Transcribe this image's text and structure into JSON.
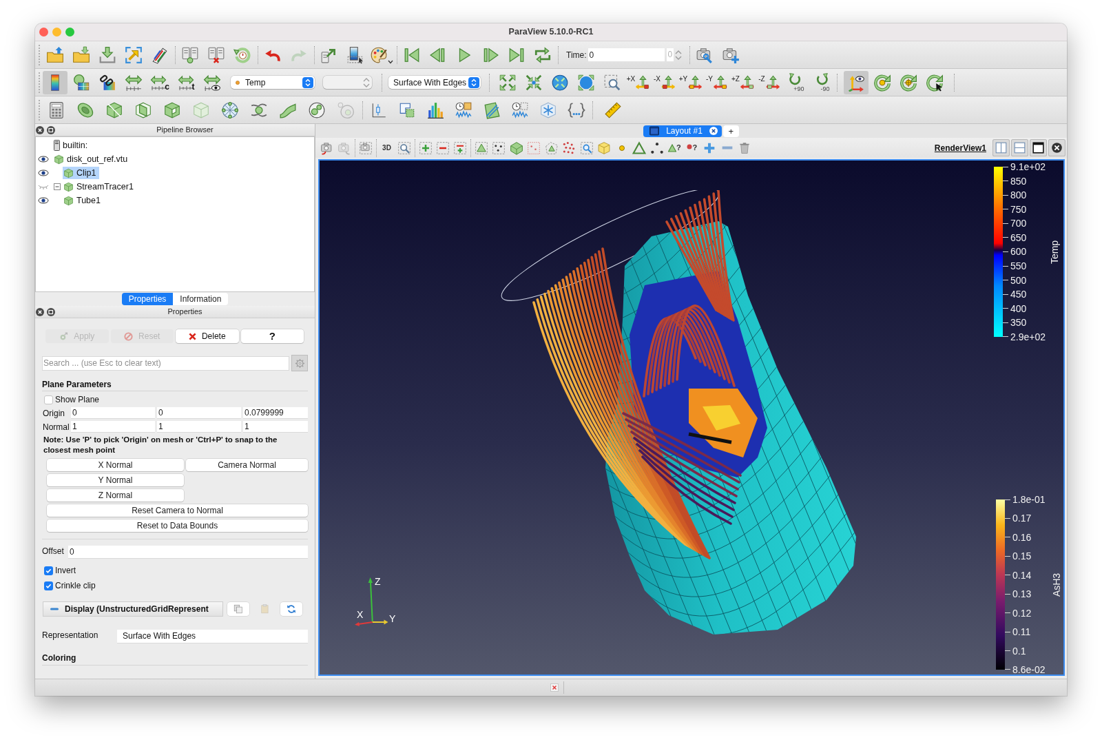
{
  "window": {
    "title": "ParaView 5.10.0-RC1"
  },
  "toolbar": {
    "time_label": "Time:",
    "time_value": "0",
    "time_index": "0",
    "color_legend_button": {
      "on": true
    },
    "rescale_marks": [
      "c",
      "t"
    ],
    "color_array": "Temp",
    "representation": "Surface With Edges",
    "view_buttons": [
      "+X",
      "-X",
      "+Y",
      "-Y",
      "+Z",
      "-Z"
    ],
    "rotate_buttons": [
      "+90",
      "-90"
    ],
    "orientation_axes_button": {
      "on": true
    }
  },
  "pipeline_browser": {
    "title": "Pipeline Browser",
    "items": [
      {
        "label": "builtin:",
        "selected": false,
        "children": [
          {
            "label": "disk_out_ref.vtu",
            "visible": true,
            "selected": false,
            "children": [
              {
                "label": "Clip1",
                "visible": true,
                "selected": true
              },
              {
                "label": "StreamTracer1",
                "visible": false,
                "selected": false,
                "expanded": true,
                "children": [
                  {
                    "label": "Tube1",
                    "visible": true,
                    "selected": false
                  }
                ]
              }
            ]
          }
        ]
      }
    ]
  },
  "panel_tabs": [
    {
      "label": "Properties",
      "selected": true
    },
    {
      "label": "Information",
      "selected": false
    }
  ],
  "properties": {
    "title": "Properties",
    "buttons": [
      {
        "label": "Apply",
        "disabled": true
      },
      {
        "label": "Reset",
        "disabled": true
      },
      {
        "label": "Delete",
        "disabled": false
      },
      {
        "label": "?",
        "disabled": false
      }
    ],
    "search": {
      "placeholder": "Search ... (use Esc to clear text)"
    },
    "plane_parameters": {
      "title": "Plane Parameters",
      "show_plane": {
        "label": "Show Plane",
        "checked": false
      },
      "vectors": [
        {
          "label": "Origin",
          "values": [
            "0",
            "0",
            "0.0799999"
          ]
        },
        {
          "label": "Normal",
          "values": [
            "1",
            "1",
            "1"
          ]
        }
      ],
      "note": "Note: Use 'P' to pick 'Origin' on mesh or 'Ctrl+P' to snap to the closest mesh point",
      "normal_buttons": [
        [
          "X Normal",
          "Camera Normal"
        ],
        [
          "Y Normal"
        ],
        [
          "Z Normal"
        ]
      ],
      "wide_buttons": [
        "Reset Camera to Normal",
        "Reset to Data Bounds"
      ]
    },
    "offset": {
      "label": "Offset",
      "value": "0"
    },
    "options": [
      {
        "label": "Invert",
        "checked": true
      },
      {
        "label": "Crinkle clip",
        "checked": true
      }
    ],
    "display": {
      "title": "Display (UnstructuredGridRepresent",
      "expanded": true,
      "representation": {
        "label": "Representation",
        "value": "Surface With Edges"
      },
      "coloring_title": "Coloring"
    }
  },
  "layout_tabs": {
    "tabs": [
      {
        "label": "Layout #1",
        "selected": true
      }
    ],
    "add": "+"
  },
  "render_toolbar": {
    "mode_button": "3D",
    "query_marks": [
      "?",
      "?"
    ],
    "view_name": "RenderView1"
  },
  "render_view": {
    "legends": [
      {
        "title": "Temp",
        "kind": "coldhot",
        "labels": [
          "9.1e+02",
          "850",
          "800",
          "750",
          "700",
          "650",
          "600",
          "550",
          "500",
          "450",
          "400",
          "350",
          "2.9e+02"
        ]
      },
      {
        "title": "AsH3",
        "kind": "inferno",
        "labels": [
          "1.8e-01",
          "0.17",
          "0.16",
          "0.15",
          "0.14",
          "0.13",
          "0.12",
          "0.11",
          "0.1",
          "8.6e-02"
        ]
      }
    ],
    "axes_labels": [
      "Z",
      "X",
      "Y"
    ]
  }
}
